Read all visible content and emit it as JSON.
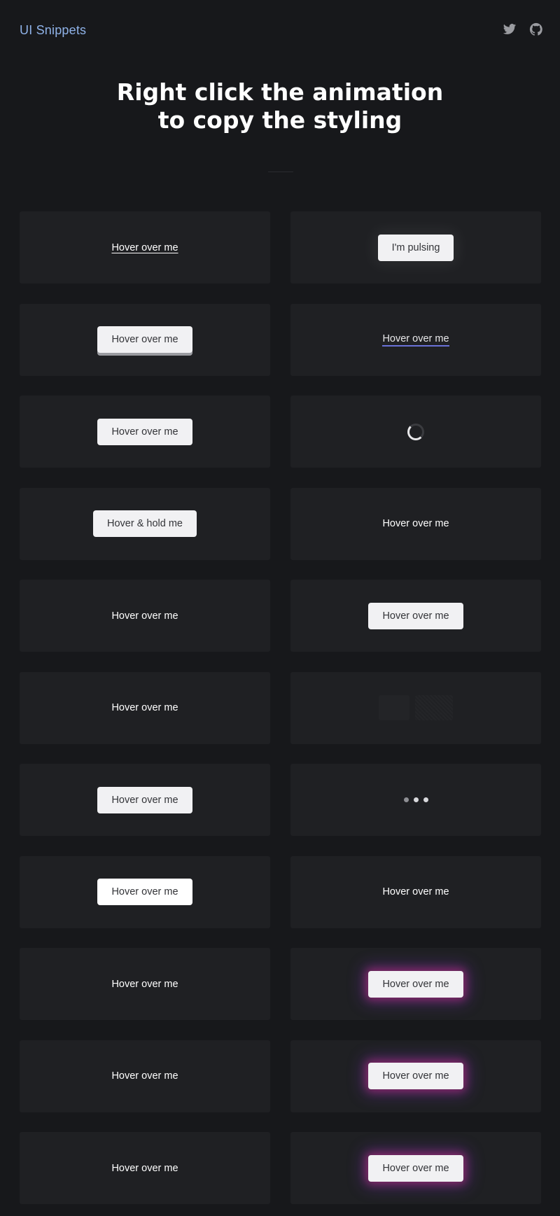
{
  "header": {
    "brand": "UI Snippets",
    "icons": [
      "twitter-icon",
      "github-icon"
    ]
  },
  "hero": {
    "title_line1": "Right click the animation",
    "title_line2": "to copy the styling"
  },
  "cards": {
    "c1": "Hover over me",
    "c2": "I'm pulsing",
    "c3": "Hover over me",
    "c4": "Hover over me",
    "c5": "Hover over me",
    "c7": "Hover & hold me",
    "c8": "Hover over me",
    "c9": "Hover over me",
    "c10": "Hover over me",
    "c11": "Hover over me",
    "c13": "Hover over me",
    "c15": "Hover over me",
    "c16": "Hover over me",
    "c17": "Hover over me",
    "c18": "Hover over me",
    "c19": "Hover over me",
    "c20": "Hover over me",
    "c21": "Hover over me",
    "c22": "Hover over me"
  },
  "colors": {
    "background": "#17181b",
    "card": "#1f2023",
    "brand": "#8fb2e8",
    "glow_pink": "#c82878",
    "glow_purple": "#8c3cdc",
    "underline_blue": "#6a72d8"
  }
}
